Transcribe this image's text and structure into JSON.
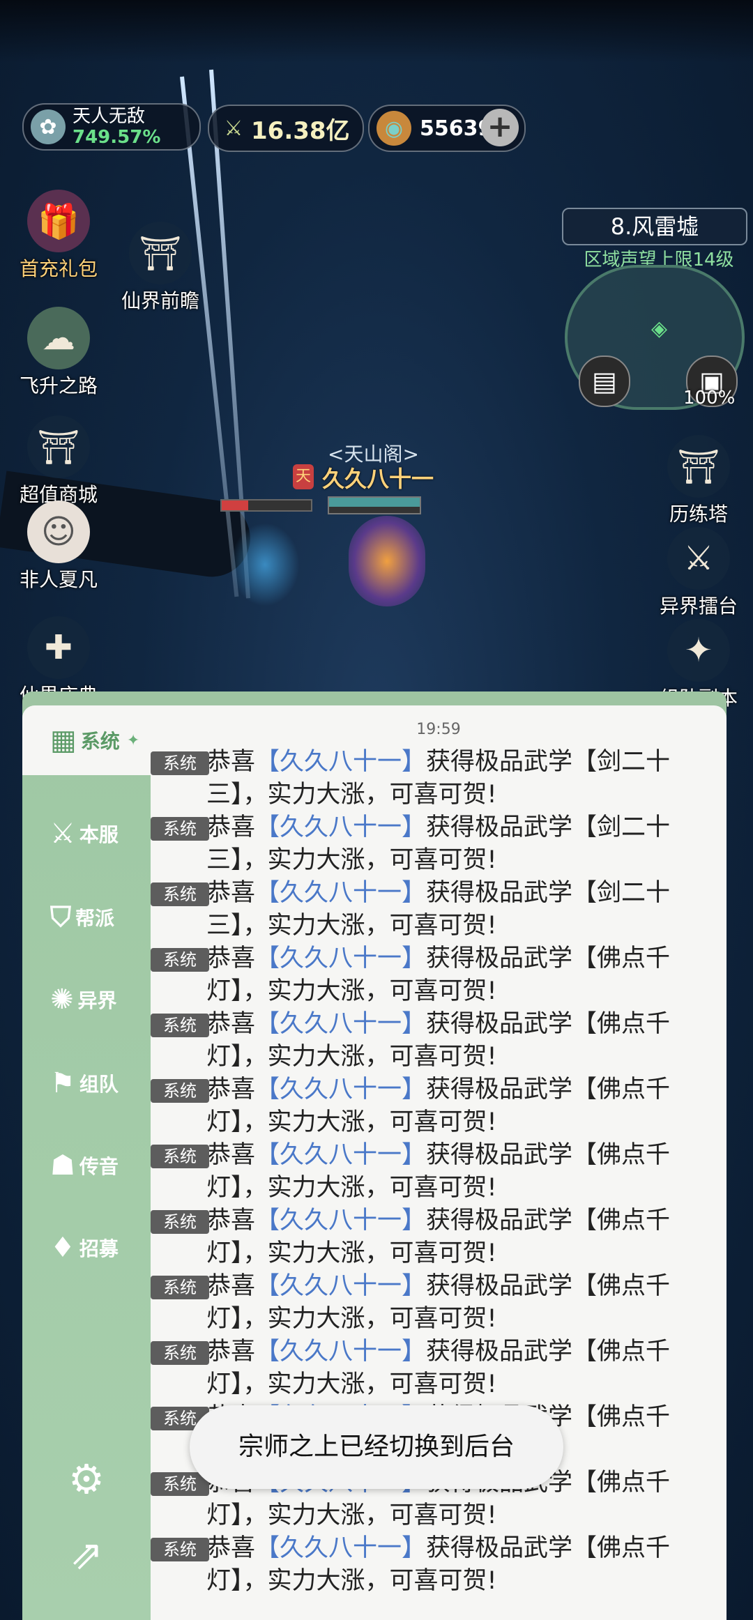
{
  "hud": {
    "title_name": "天人无敌",
    "title_percent": "749.57%",
    "combat_power": "16.38亿",
    "currency": "55639",
    "plus": "+"
  },
  "left_menu": [
    {
      "label": "首充礼包",
      "icon": "gift-icon"
    },
    {
      "label": "仙界前瞻",
      "icon": "palace-icon"
    },
    {
      "label": "飞升之路",
      "icon": "ascend-icon"
    },
    {
      "label": "超值商城",
      "icon": "shop-icon"
    },
    {
      "label": "非人夏凡",
      "icon": "character-icon"
    },
    {
      "label": "仙界庆典",
      "icon": "celebration-icon"
    }
  ],
  "right_menu": [
    {
      "label": "历练塔",
      "icon": "tower-icon"
    },
    {
      "label": "异界擂台",
      "icon": "arena-icon"
    },
    {
      "label": "组队副本",
      "icon": "team-dungeon-icon"
    }
  ],
  "minimap": {
    "zone": "8.风雷墟",
    "region_note": "区域声望上限14级",
    "bag_percent": "100%"
  },
  "player": {
    "guild": "<天山阁>",
    "name": "久久八十一",
    "title_badge": "天"
  },
  "chat": {
    "tabs": [
      {
        "label": "系统",
        "icon": "system-icon"
      },
      {
        "label": "本服",
        "icon": "server-icon"
      },
      {
        "label": "帮派",
        "icon": "guild-icon"
      },
      {
        "label": "异界",
        "icon": "otherworld-icon"
      },
      {
        "label": "组队",
        "icon": "team-icon"
      },
      {
        "label": "传音",
        "icon": "whisper-icon"
      },
      {
        "label": "招募",
        "icon": "recruit-icon"
      }
    ],
    "time": "19:59",
    "badge": "系统",
    "messages": [
      {
        "pre": "恭喜",
        "name": "【久久八十一】",
        "post": "获得极品武学【剑二十三】，实力大涨，可喜可贺!"
      },
      {
        "pre": "恭喜",
        "name": "【久久八十一】",
        "post": "获得极品武学【剑二十三】，实力大涨，可喜可贺!"
      },
      {
        "pre": "恭喜",
        "name": "【久久八十一】",
        "post": "获得极品武学【剑二十三】，实力大涨，可喜可贺!"
      },
      {
        "pre": "恭喜",
        "name": "【久久八十一】",
        "post": "获得极品武学【佛点千灯】，实力大涨，可喜可贺!"
      },
      {
        "pre": "恭喜",
        "name": "【久久八十一】",
        "post": "获得极品武学【佛点千灯】，实力大涨，可喜可贺!"
      },
      {
        "pre": "恭喜",
        "name": "【久久八十一】",
        "post": "获得极品武学【佛点千灯】，实力大涨，可喜可贺!"
      },
      {
        "pre": "恭喜",
        "name": "【久久八十一】",
        "post": "获得极品武学【佛点千灯】，实力大涨，可喜可贺!"
      },
      {
        "pre": "恭喜",
        "name": "【久久八十一】",
        "post": "获得极品武学【佛点千灯】，实力大涨，可喜可贺!"
      },
      {
        "pre": "恭喜",
        "name": "【久久八十一】",
        "post": "获得极品武学【佛点千灯】，实力大涨，可喜可贺!"
      },
      {
        "pre": "恭喜",
        "name": "【久久八十一】",
        "post": "获得极品武学【佛点千灯】，实力大涨，可喜可贺!"
      },
      {
        "pre": "恭喜",
        "name": "【久久八十一】",
        "post": "获得极品武学【佛点千灯】，实力大涨，可喜可贺!"
      },
      {
        "pre": "恭喜",
        "name": "【久久八十一】",
        "post": "获得极品武学【佛点千灯】，实力大涨，可喜可贺!"
      },
      {
        "pre": "恭喜",
        "name": "【久久八十一】",
        "post": "获得极品武学【佛点千灯】，实力大涨，可喜可贺!"
      }
    ]
  },
  "toast": "宗师之上已经切换到后台",
  "colors": {
    "panel_green": "#9fc8a4",
    "name_blue": "#4a78c8",
    "gold_text": "#ffd27a"
  }
}
